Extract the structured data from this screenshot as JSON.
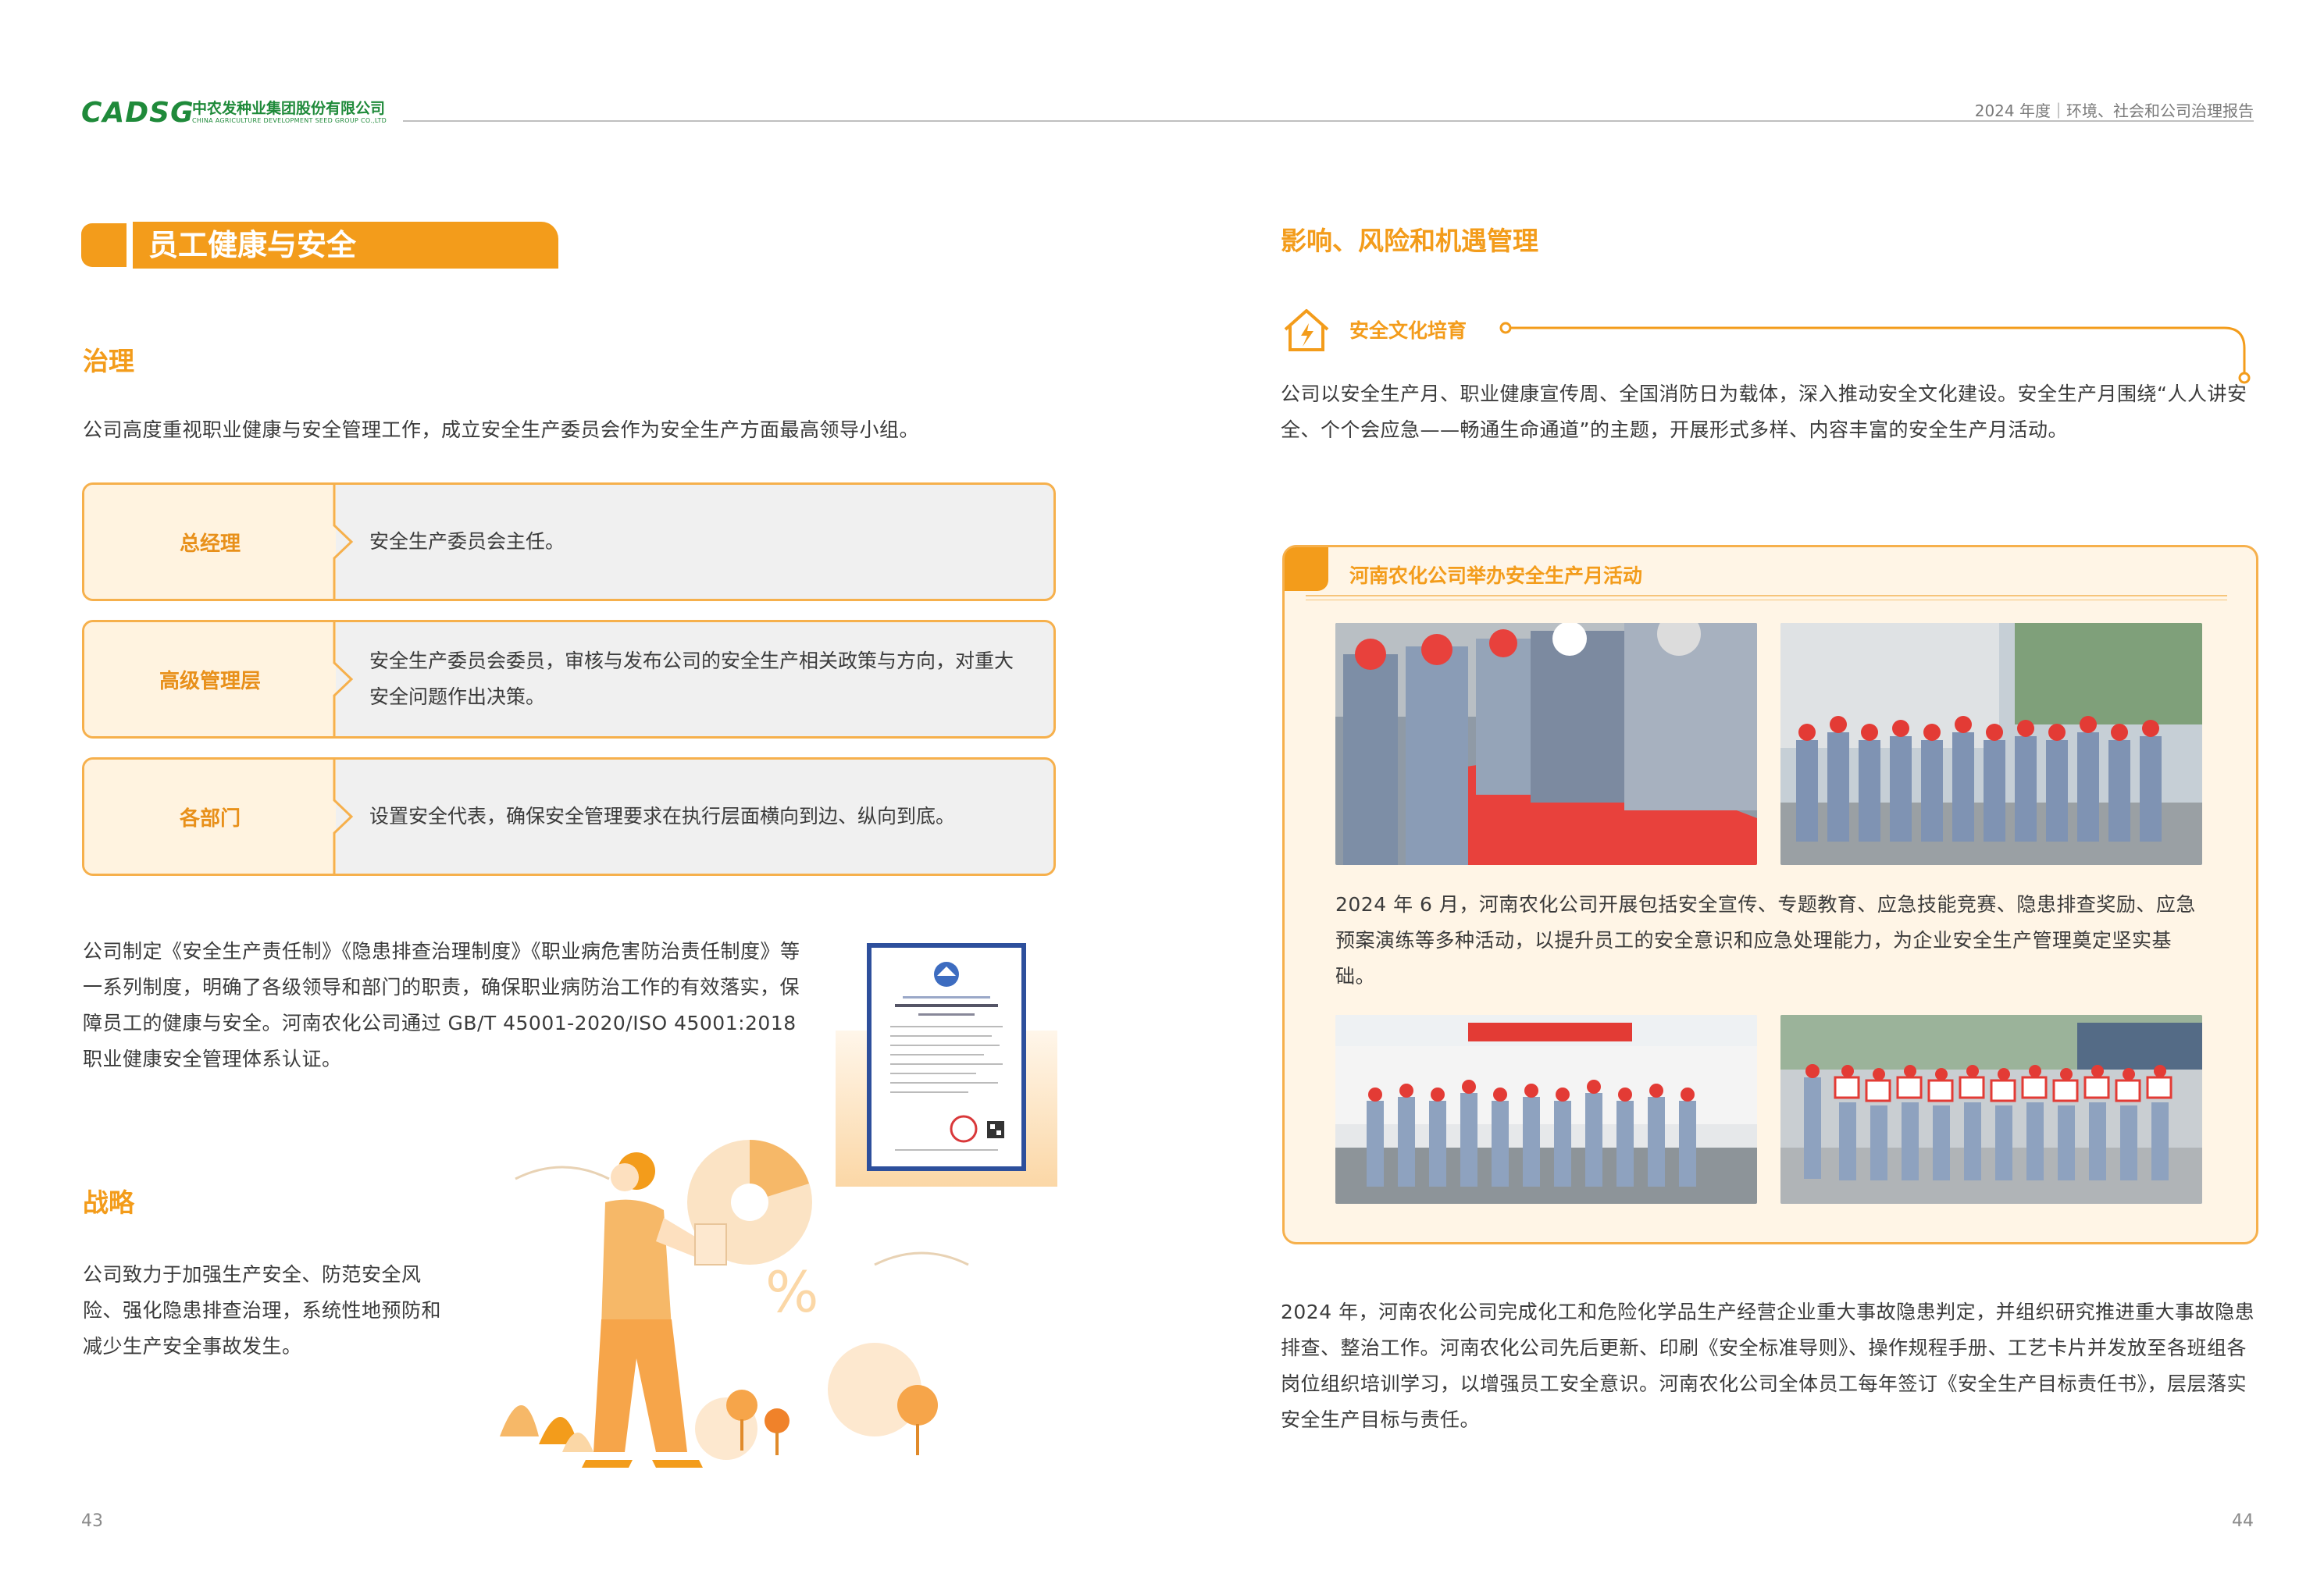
{
  "header": {
    "logo_text": "CADSG",
    "company_cn": "中农发种业集团股份有限公司",
    "company_en": "CHINA AGRICULTURE DEVELOPMENT SEED GROUP CO.,LTD",
    "report_title": "2024 年度｜环境、社会和公司治理报告"
  },
  "left": {
    "section_title": "员工健康与安全",
    "governance": {
      "heading": "治理",
      "intro": "公司高度重视职业健康与安全管理工作，成立安全生产委员会作为安全生产方面最高领导小组。",
      "rows": [
        {
          "role": "总经理",
          "desc": "安全生产委员会主任。"
        },
        {
          "role": "高级管理层",
          "desc": "安全生产委员会委员，审核与发布公司的安全生产相关政策与方向，对重大安全问题作出决策。"
        },
        {
          "role": "各部门",
          "desc": "设置安全代表，确保安全管理要求在执行层面横向到边、纵向到底。"
        }
      ],
      "policy_paragraph": "公司制定《安全生产责任制》《隐患排查治理制度》《职业病危害防治责任制度》等一系列制度，明确了各级领导和部门的职责，确保职业病防治工作的有效落实，保障员工的健康与安全。河南农化公司通过 GB/T 45001-2020/ISO 45001:2018 职业健康安全管理体系认证。"
    },
    "strategy": {
      "heading": "战略",
      "paragraph": "公司致力于加强生产安全、防范安全风险、强化隐患排查治理，系统性地预防和减少生产安全事故发生。"
    },
    "page_number": "43"
  },
  "right": {
    "heading": "影响、风险和机遇管理",
    "subheading": "安全文化培育",
    "culture_paragraph": "公司以安全生产月、职业健康宣传周、全国消防日为载体，深入推动安全文化建设。安全生产月围绕“人人讲安全、个个会应急——畅通生命通道”的主题，开展形式多样、内容丰富的安全生产月活动。",
    "activity_box": {
      "title": "河南农化公司举办安全生产月活动",
      "caption": "2024 年 6 月，河南农化公司开展包括安全宣传、专题教育、应急技能竞赛、隐患排查奖励、应急预案演练等多种活动，以提升员工的安全意识和应急处理能力，为企业安全生产管理奠定坚实基础。"
    },
    "closing_paragraph": "2024 年，河南农化公司完成化工和危险化学品生产经营企业重大事故隐患判定，并组织研究推进重大事故隐患排查、整治工作。河南农化公司先后更新、印刷《安全标准导则》、操作规程手册、工艺卡片并发放至各班组各岗位组织培训学习，以增强员工安全意识。河南农化公司全体员工每年签订《安全生产目标责任书》，层层落实安全生产目标与责任。",
    "page_number": "44"
  },
  "colors": {
    "accent": "#f39c1b",
    "brand_green": "#1f8a3a",
    "certificate_border": "#2d4f9c"
  }
}
